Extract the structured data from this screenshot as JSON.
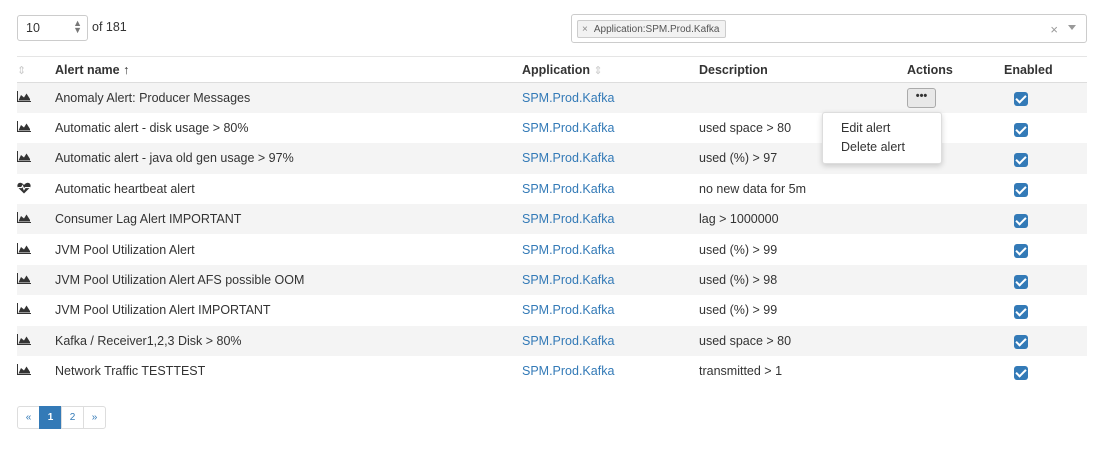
{
  "pagination_top": {
    "page_size": "10",
    "of_total": "of 181"
  },
  "filter": {
    "tag_label": "Application:SPM.Prod.Kafka",
    "tag_remove": "×",
    "clear": "×"
  },
  "table": {
    "headers": {
      "icon": "⇕",
      "name": "Alert name",
      "name_sort": "↑",
      "application": "Application",
      "application_sort": "⇕",
      "description": "Description",
      "actions": "Actions",
      "enabled": "Enabled"
    },
    "rows": [
      {
        "icon": "area-chart-icon",
        "name": "Anomaly Alert: Producer Messages",
        "application": "SPM.Prod.Kafka",
        "description": "",
        "enabled": true
      },
      {
        "icon": "area-chart-icon",
        "name": "Automatic alert - disk usage > 80%",
        "application": "SPM.Prod.Kafka",
        "description": "used space > 80",
        "enabled": true
      },
      {
        "icon": "area-chart-icon",
        "name": "Automatic alert - java old gen usage > 97%",
        "application": "SPM.Prod.Kafka",
        "description": "used (%) > 97",
        "enabled": true
      },
      {
        "icon": "heartbeat-icon",
        "name": "Automatic heartbeat alert",
        "application": "SPM.Prod.Kafka",
        "description": "no new data for 5m",
        "enabled": true
      },
      {
        "icon": "area-chart-icon",
        "name": "Consumer Lag Alert IMPORTANT",
        "application": "SPM.Prod.Kafka",
        "description": "lag > 1000000",
        "enabled": true
      },
      {
        "icon": "area-chart-icon",
        "name": "JVM Pool Utilization Alert",
        "application": "SPM.Prod.Kafka",
        "description": "used (%) > 99",
        "enabled": true
      },
      {
        "icon": "area-chart-icon",
        "name": "JVM Pool Utilization Alert AFS possible OOM",
        "application": "SPM.Prod.Kafka",
        "description": "used (%) > 98",
        "enabled": true
      },
      {
        "icon": "area-chart-icon",
        "name": "JVM Pool Utilization Alert IMPORTANT",
        "application": "SPM.Prod.Kafka",
        "description": "used (%) > 99",
        "enabled": true
      },
      {
        "icon": "area-chart-icon",
        "name": "Kafka / Receiver1,2,3 Disk > 80%",
        "application": "SPM.Prod.Kafka",
        "description": "used space > 80",
        "enabled": true
      },
      {
        "icon": "area-chart-icon",
        "name": "Network Traffic TESTTEST",
        "application": "SPM.Prod.Kafka",
        "description": "transmitted > 1",
        "enabled": true
      }
    ],
    "actions_button": "•••"
  },
  "actions_menu": {
    "edit": "Edit alert",
    "delete": "Delete alert"
  },
  "pager": {
    "prev": "«",
    "pages": [
      "1",
      "2"
    ],
    "active_page": "1",
    "next": "»"
  },
  "colors": {
    "accent": "#337ab7",
    "row_stripe": "#f4f4f4"
  }
}
